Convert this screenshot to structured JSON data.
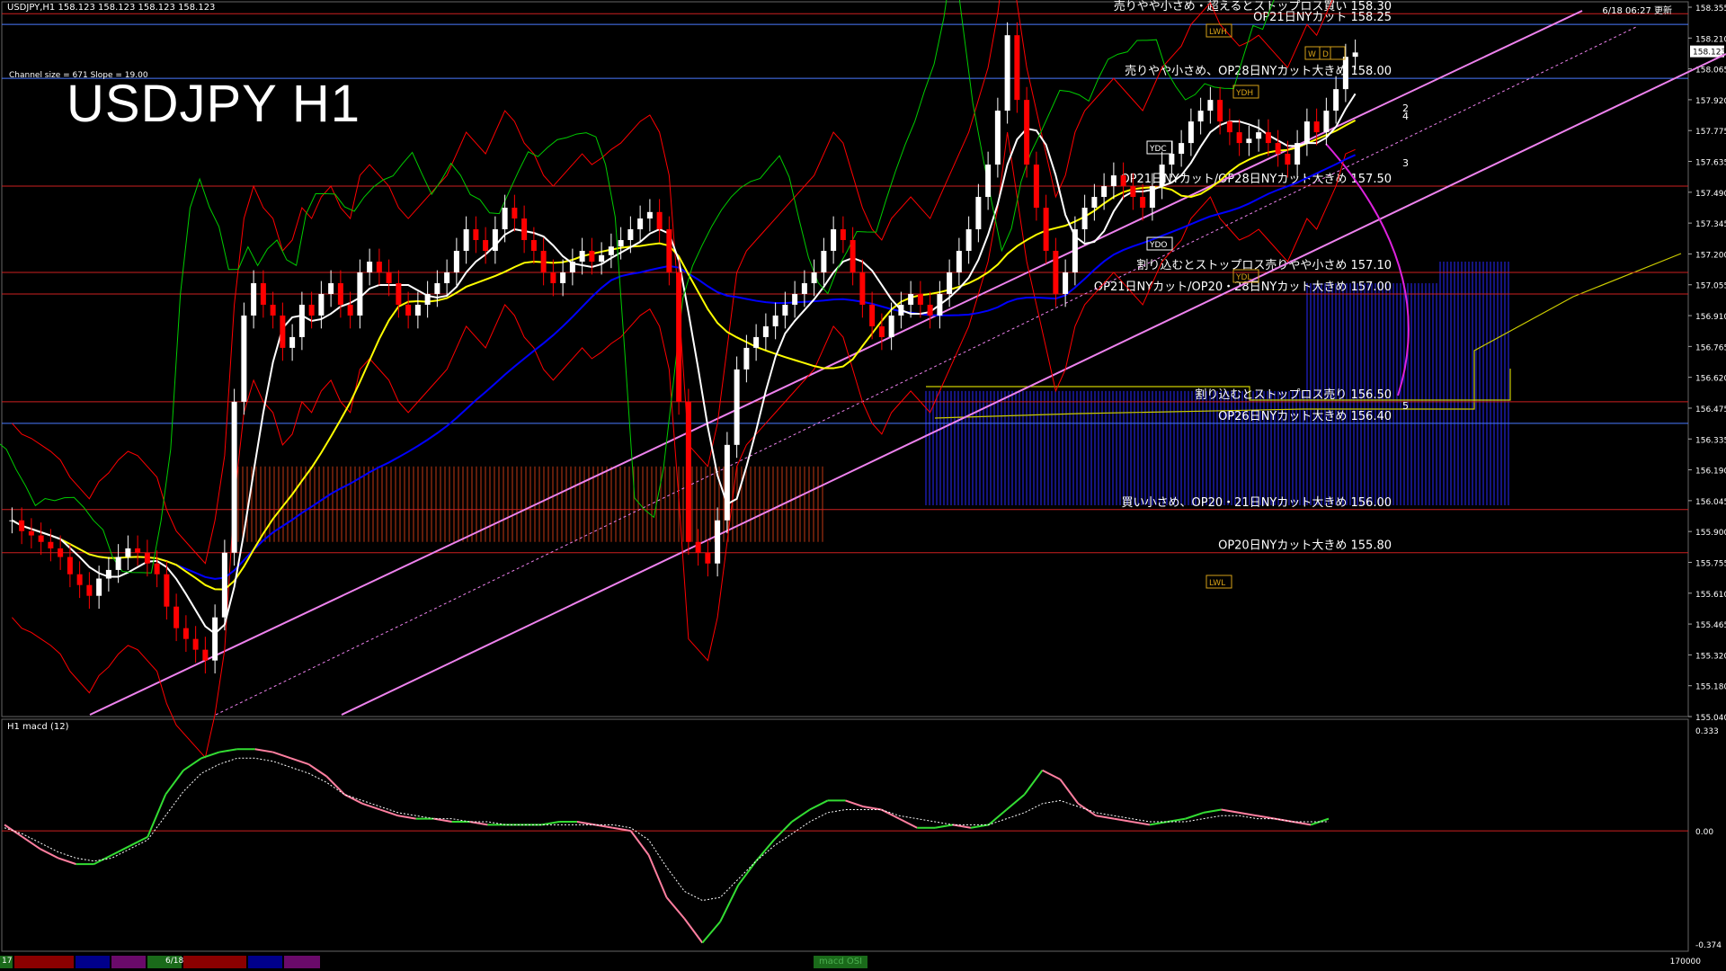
{
  "window": {
    "header": "USDJPY,H1  158.123 158.123 158.123 158.123",
    "title": "USDJPY H1",
    "channel_info": "Channel size = 671 Slope = 19.00",
    "clock": "6/18 06:27 更新",
    "macd_label": "H1  macd (12)",
    "bottom_left": "17",
    "bottom_date": "6/18",
    "macd_button": "macd OSI",
    "bottom_right": "170000"
  },
  "colors": {
    "background": "#000000",
    "bull_candle": "#ffffff",
    "bear_candle": "#ff0000",
    "channel": "#ee82ee",
    "ma_yellow": "#ffff00",
    "ma_white": "#ffffff",
    "ma_blue": "#0000ff",
    "bollinger": "#ff0000",
    "chikou": "#00cc00",
    "macd_up": "#33dd33",
    "macd_down": "#ff7fa0"
  },
  "chart_data": [
    {
      "type": "line",
      "title": "USDJPY H1",
      "ylim": [
        155.04,
        158.33
      ],
      "y_ticks": [
        "158.355",
        "158.210",
        "158.065",
        "157.920",
        "157.775",
        "157.635",
        "157.490",
        "157.345",
        "157.200",
        "157.055",
        "156.910",
        "156.765",
        "156.620",
        "156.475",
        "156.335",
        "156.190",
        "156.045",
        "155.900",
        "155.755",
        "155.610",
        "155.465",
        "155.320",
        "155.180",
        "155.040"
      ],
      "current_price": "158.123",
      "annotations": [
        {
          "price": 158.3,
          "text": "売りやや小さめ・超えるとストップロス買い 158.30"
        },
        {
          "price": 158.25,
          "text": "OP21日NYカット 158.25"
        },
        {
          "price": 158.0,
          "text": "売りやや小さめ、OP28日NYカット大きめ 158.00"
        },
        {
          "price": 157.5,
          "text": "OP21日NYカット/OP28日NYカット大きめ 157.50"
        },
        {
          "price": 157.1,
          "text": "割り込むとストップロス売りやや小さめ 157.10"
        },
        {
          "price": 157.0,
          "text": "OP21日NYカット/OP20・28日NYカット大きめ 157.00"
        },
        {
          "price": 156.5,
          "text": "割り込むとストップロス売り 156.50"
        },
        {
          "price": 156.4,
          "text": "OP26日NYカット大きめ 156.40"
        },
        {
          "price": 156.0,
          "text": "買い小さめ、OP20・21日NYカット大きめ 156.00"
        },
        {
          "price": 155.8,
          "text": "OP20日NYカット大きめ 155.80"
        }
      ],
      "boxes": [
        "LWH",
        "YDH",
        "YDC",
        "YDO",
        "YDL",
        "W",
        "D",
        "LWL"
      ],
      "projection_labels": [
        "2",
        "3",
        "4",
        "5"
      ],
      "close": [
        155.95,
        155.9,
        155.88,
        155.85,
        155.82,
        155.78,
        155.7,
        155.65,
        155.6,
        155.68,
        155.72,
        155.78,
        155.82,
        155.8,
        155.75,
        155.7,
        155.55,
        155.45,
        155.4,
        155.35,
        155.3,
        155.5,
        155.8,
        156.5,
        156.9,
        157.05,
        156.95,
        156.9,
        156.75,
        156.8,
        156.95,
        156.9,
        157.0,
        157.05,
        156.95,
        156.9,
        157.1,
        157.15,
        157.1,
        157.05,
        156.95,
        156.9,
        156.95,
        157.0,
        157.05,
        157.1,
        157.2,
        157.3,
        157.25,
        157.2,
        157.3,
        157.4,
        157.35,
        157.25,
        157.2,
        157.1,
        157.05,
        157.1,
        157.15,
        157.2,
        157.15,
        157.18,
        157.22,
        157.25,
        157.3,
        157.35,
        157.38,
        157.3,
        157.1,
        156.5,
        155.85,
        155.8,
        155.75,
        155.95,
        156.3,
        156.65,
        156.75,
        156.8,
        156.85,
        156.9,
        156.95,
        157.0,
        157.05,
        157.1,
        157.2,
        157.3,
        157.25,
        157.1,
        156.95,
        156.85,
        156.8,
        156.9,
        156.95,
        157.0,
        156.95,
        156.9,
        157.0,
        157.1,
        157.2,
        157.3,
        157.45,
        157.6,
        157.85,
        158.2,
        157.9,
        157.6,
        157.4,
        157.2,
        157.0,
        157.1,
        157.3,
        157.4,
        157.45,
        157.5,
        157.55,
        157.5,
        157.45,
        157.4,
        157.5,
        157.6,
        157.65,
        157.7,
        157.8,
        157.85,
        157.9,
        157.8,
        157.75,
        157.7,
        157.72,
        157.75,
        157.7,
        157.65,
        157.6,
        157.7,
        157.8,
        157.75,
        157.85,
        157.95,
        158.1,
        158.12
      ],
      "macd_ylim": [
        -0.374,
        0.333
      ],
      "macd_ticks": [
        "0.333",
        "0.00",
        "-0.374"
      ],
      "macd": [
        0.02,
        -0.02,
        -0.06,
        -0.09,
        -0.11,
        -0.11,
        -0.08,
        -0.05,
        -0.02,
        0.12,
        0.2,
        0.24,
        0.26,
        0.27,
        0.27,
        0.26,
        0.24,
        0.22,
        0.18,
        0.12,
        0.09,
        0.07,
        0.05,
        0.04,
        0.04,
        0.03,
        0.03,
        0.02,
        0.02,
        0.02,
        0.02,
        0.03,
        0.03,
        0.02,
        0.01,
        0.0,
        -0.08,
        -0.22,
        -0.29,
        -0.37,
        -0.3,
        -0.18,
        -0.1,
        -0.03,
        0.03,
        0.07,
        0.1,
        0.1,
        0.08,
        0.07,
        0.04,
        0.01,
        0.01,
        0.02,
        0.01,
        0.02,
        0.07,
        0.12,
        0.2,
        0.17,
        0.09,
        0.05,
        0.04,
        0.03,
        0.02,
        0.03,
        0.04,
        0.06,
        0.07,
        0.06,
        0.05,
        0.04,
        0.03,
        0.02,
        0.04
      ],
      "signal": [
        0.01,
        -0.01,
        -0.04,
        -0.07,
        -0.09,
        -0.1,
        -0.09,
        -0.06,
        -0.03,
        0.05,
        0.13,
        0.19,
        0.22,
        0.24,
        0.24,
        0.23,
        0.21,
        0.19,
        0.16,
        0.12,
        0.1,
        0.08,
        0.06,
        0.05,
        0.04,
        0.04,
        0.03,
        0.03,
        0.02,
        0.02,
        0.02,
        0.02,
        0.02,
        0.02,
        0.02,
        0.01,
        -0.03,
        -0.12,
        -0.2,
        -0.23,
        -0.22,
        -0.16,
        -0.1,
        -0.05,
        -0.01,
        0.03,
        0.06,
        0.07,
        0.07,
        0.07,
        0.05,
        0.04,
        0.03,
        0.02,
        0.02,
        0.02,
        0.04,
        0.06,
        0.09,
        0.1,
        0.08,
        0.06,
        0.05,
        0.04,
        0.03,
        0.03,
        0.03,
        0.04,
        0.05,
        0.05,
        0.04,
        0.04,
        0.03,
        0.03,
        0.03
      ]
    }
  ]
}
